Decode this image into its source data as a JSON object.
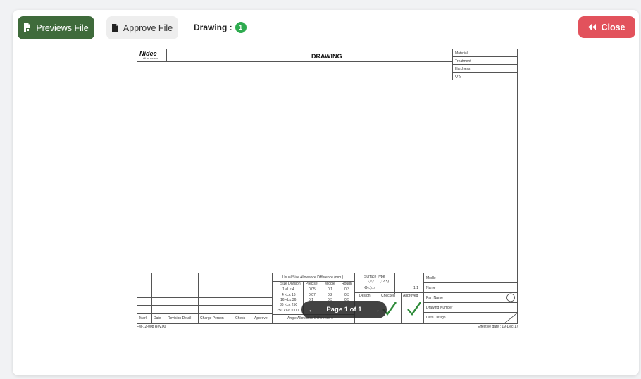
{
  "toolbar": {
    "previews_label": "Previews File",
    "approve_label": "Approve File",
    "drawing_label": "Drawing :",
    "drawing_count": "1",
    "close_label": "Close"
  },
  "sheet": {
    "logo_text": "Nidec",
    "logo_tagline": "All for dreams",
    "title": "DRAWING",
    "props": [
      "Material",
      "Treatment",
      "Hardness",
      "Q'ty"
    ],
    "footer_left": "FM-12-008 Rev.00",
    "footer_right": "Effective date : 19-Dec-17",
    "revision_headers": [
      "Mark",
      "Date",
      "Revision Detail",
      "Charge Person",
      "Check",
      "Approve"
    ],
    "tolerance_title": "Usual Size Allowance Difference (mm.)",
    "tolerance_headers": [
      "Size Division",
      "Precise",
      "Middle",
      "Rough"
    ],
    "tolerance_rows": [
      [
        "1 <L≤ 4",
        "0.05",
        "0.1",
        "0.3"
      ],
      [
        "4 <L≤ 16",
        "0.07",
        "0.2",
        "0.3"
      ],
      [
        "16 <L≤ 36",
        "0.1",
        "0.3",
        "0.5"
      ],
      [
        "36 <L≤ 250",
        "",
        "",
        ""
      ],
      [
        "250 <L≤ 1000",
        "",
        "",
        ""
      ]
    ],
    "angle_label": "Angle Allowance Difference ±",
    "surface_label": "Surface Type",
    "surface_value": "(12.5)",
    "scale": "1:1",
    "sign_headers": [
      "Design",
      "Checked",
      "Approved"
    ],
    "title_fields": [
      "Modle",
      "Name",
      "Part Name",
      "Drawing Number",
      "Date Design"
    ]
  },
  "pager": {
    "prev_icon": "arrow-left-icon",
    "label": "Page 1 of 1",
    "next_icon": "arrow-right-icon"
  }
}
